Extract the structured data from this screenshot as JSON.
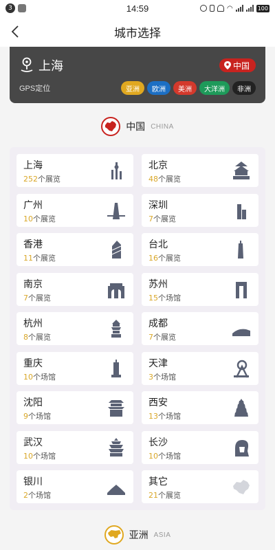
{
  "status_bar": {
    "notification_count": "3",
    "time": "14:59",
    "battery": "100"
  },
  "nav": {
    "title": "城市选择"
  },
  "gps": {
    "current_city": "上海",
    "label": "GPS定位",
    "country": "中国",
    "continents": [
      {
        "label": "亚洲",
        "color": "#e0a820"
      },
      {
        "label": "欧洲",
        "color": "#1c6fc4"
      },
      {
        "label": "美洲",
        "color": "#d4392c"
      },
      {
        "label": "大洋洲",
        "color": "#1e9a5a"
      },
      {
        "label": "非洲",
        "color": "#222222"
      }
    ]
  },
  "section_china": {
    "name_cn": "中国",
    "name_en": "CHINA",
    "emblem_color": "#c8231f"
  },
  "cities": [
    {
      "name": "上海",
      "count": "252",
      "unit": "个展览",
      "icon": "shanghai-tower-icon"
    },
    {
      "name": "北京",
      "count": "48",
      "unit": "个展览",
      "icon": "temple-of-heaven-icon"
    },
    {
      "name": "广州",
      "count": "10",
      "unit": "个展览",
      "icon": "canton-tower-icon"
    },
    {
      "name": "深圳",
      "count": "7",
      "unit": "个展览",
      "icon": "shenzhen-tower-icon"
    },
    {
      "name": "香港",
      "count": "11",
      "unit": "个展览",
      "icon": "bank-of-china-tower-icon"
    },
    {
      "name": "台北",
      "count": "16",
      "unit": "个展览",
      "icon": "taipei-101-icon"
    },
    {
      "name": "南京",
      "count": "7",
      "unit": "个展览",
      "icon": "city-gate-icon"
    },
    {
      "name": "苏州",
      "count": "15",
      "unit": "个场馆",
      "icon": "gate-of-orient-icon"
    },
    {
      "name": "杭州",
      "count": "8",
      "unit": "个展览",
      "icon": "pagoda-icon"
    },
    {
      "name": "成都",
      "count": "7",
      "unit": "个展览",
      "icon": "building-skyline-icon"
    },
    {
      "name": "重庆",
      "count": "10",
      "unit": "个场馆",
      "icon": "liberation-monument-icon"
    },
    {
      "name": "天津",
      "count": "3",
      "unit": "个场馆",
      "icon": "tianjin-eye-icon"
    },
    {
      "name": "沈阳",
      "count": "9",
      "unit": "个场馆",
      "icon": "palace-icon"
    },
    {
      "name": "西安",
      "count": "13",
      "unit": "个场馆",
      "icon": "giant-wild-goose-pagoda-icon"
    },
    {
      "name": "武汉",
      "count": "10",
      "unit": "个场馆",
      "icon": "yellow-crane-tower-icon"
    },
    {
      "name": "长沙",
      "count": "10",
      "unit": "个场馆",
      "icon": "mao-statue-icon"
    },
    {
      "name": "银川",
      "count": "2",
      "unit": "个场馆",
      "icon": "west-xia-tombs-icon"
    },
    {
      "name": "其它",
      "count": "21",
      "unit": "个展览",
      "icon": "china-map-icon"
    }
  ],
  "section_asia": {
    "name_cn": "亚洲",
    "name_en": "ASIA",
    "emblem_color": "#e0a820"
  }
}
